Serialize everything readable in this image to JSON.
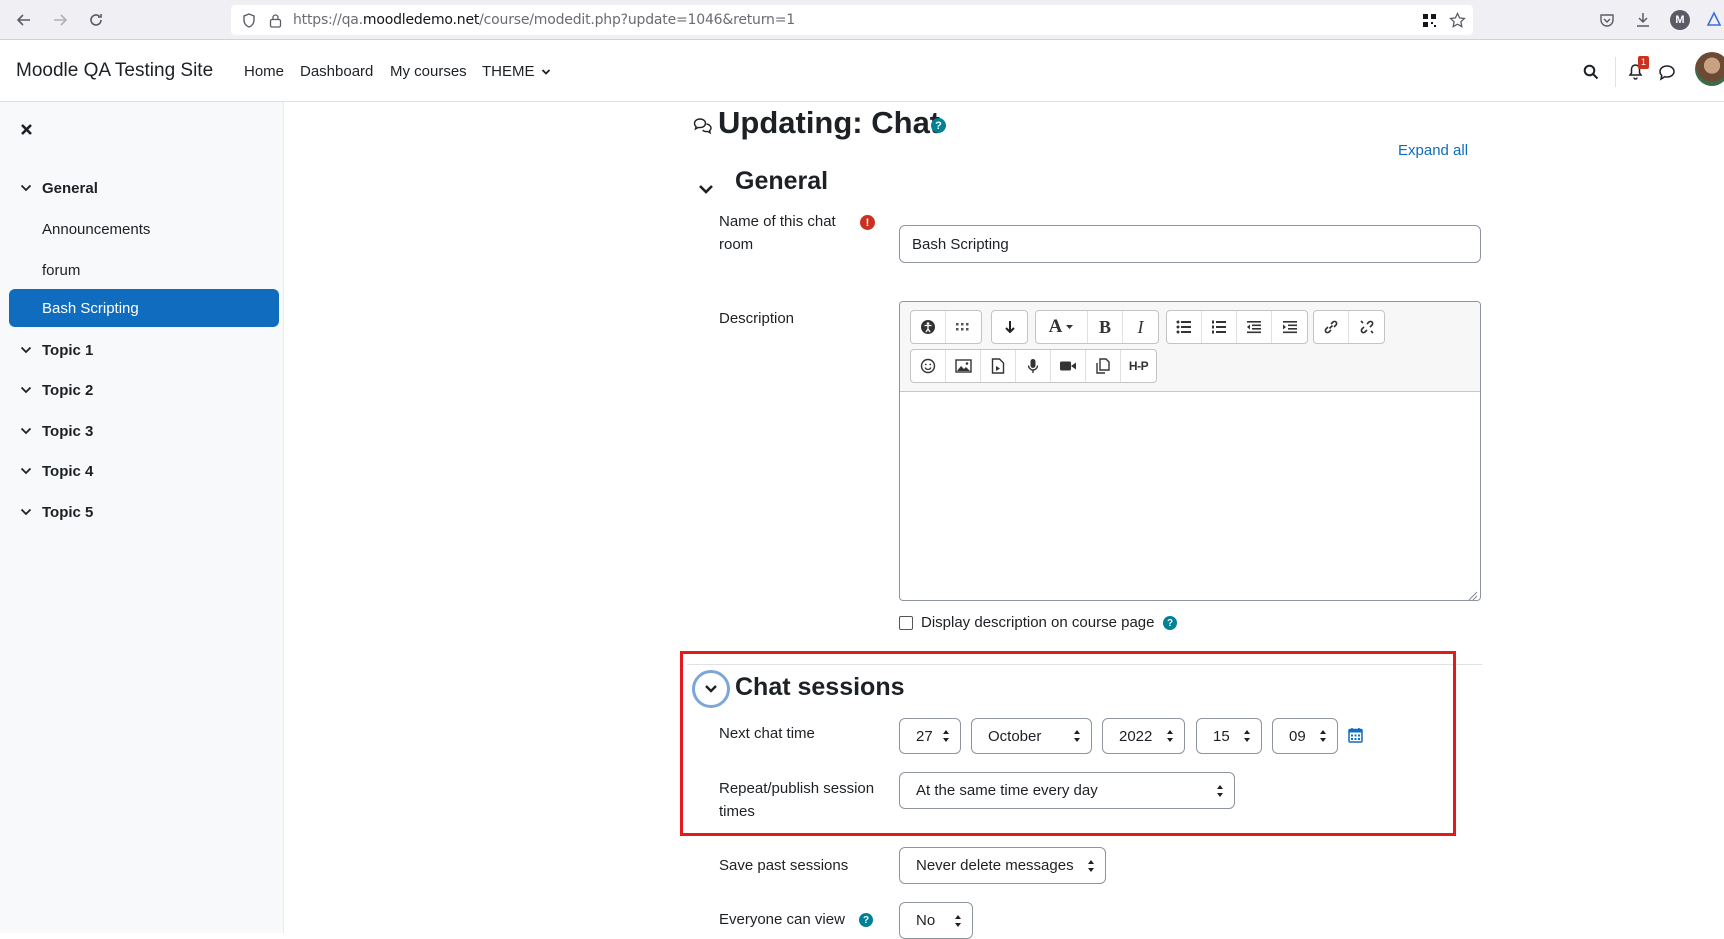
{
  "browser": {
    "url_prefix": "https://qa.",
    "url_domain": "moodledemo.net",
    "url_path": "/course/modedit.php?update=1046&return=1"
  },
  "navbar": {
    "site_name": "Moodle QA Testing Site",
    "links": [
      "Home",
      "Dashboard",
      "My courses",
      "THEME"
    ],
    "notification_count": "1"
  },
  "drawer": {
    "items": [
      {
        "label": "General",
        "type": "section"
      },
      {
        "label": "Announcements",
        "type": "activity"
      },
      {
        "label": "forum",
        "type": "activity"
      },
      {
        "label": "Bash Scripting",
        "type": "activity-active"
      },
      {
        "label": "Topic 1",
        "type": "section"
      },
      {
        "label": "Topic 2",
        "type": "section"
      },
      {
        "label": "Topic 3",
        "type": "section"
      },
      {
        "label": "Topic 4",
        "type": "section"
      },
      {
        "label": "Topic 5",
        "type": "section"
      }
    ]
  },
  "page": {
    "title": "Updating: Chat",
    "expand_all": "Expand all"
  },
  "general": {
    "heading": "General",
    "name_label": "Name of this chat room",
    "name_value": "Bash Scripting",
    "description_label": "Description",
    "display_description_label": "Display description on course page"
  },
  "chat_sessions": {
    "heading": "Chat sessions",
    "next_chat_time_label": "Next chat time",
    "day": "27",
    "month": "October",
    "year": "2022",
    "hour": "15",
    "minute": "09",
    "repeat_label": "Repeat/publish session times",
    "repeat_value": "At the same time every day",
    "save_past_label": "Save past sessions",
    "save_past_value": "Never delete messages",
    "everyone_view_label": "Everyone can view",
    "everyone_view_value": "No"
  },
  "colors": {
    "brand_primary": "#0f6cbf",
    "required_red": "#ca3120",
    "help_teal": "#008196",
    "highlight_box": "#e31a1c"
  }
}
